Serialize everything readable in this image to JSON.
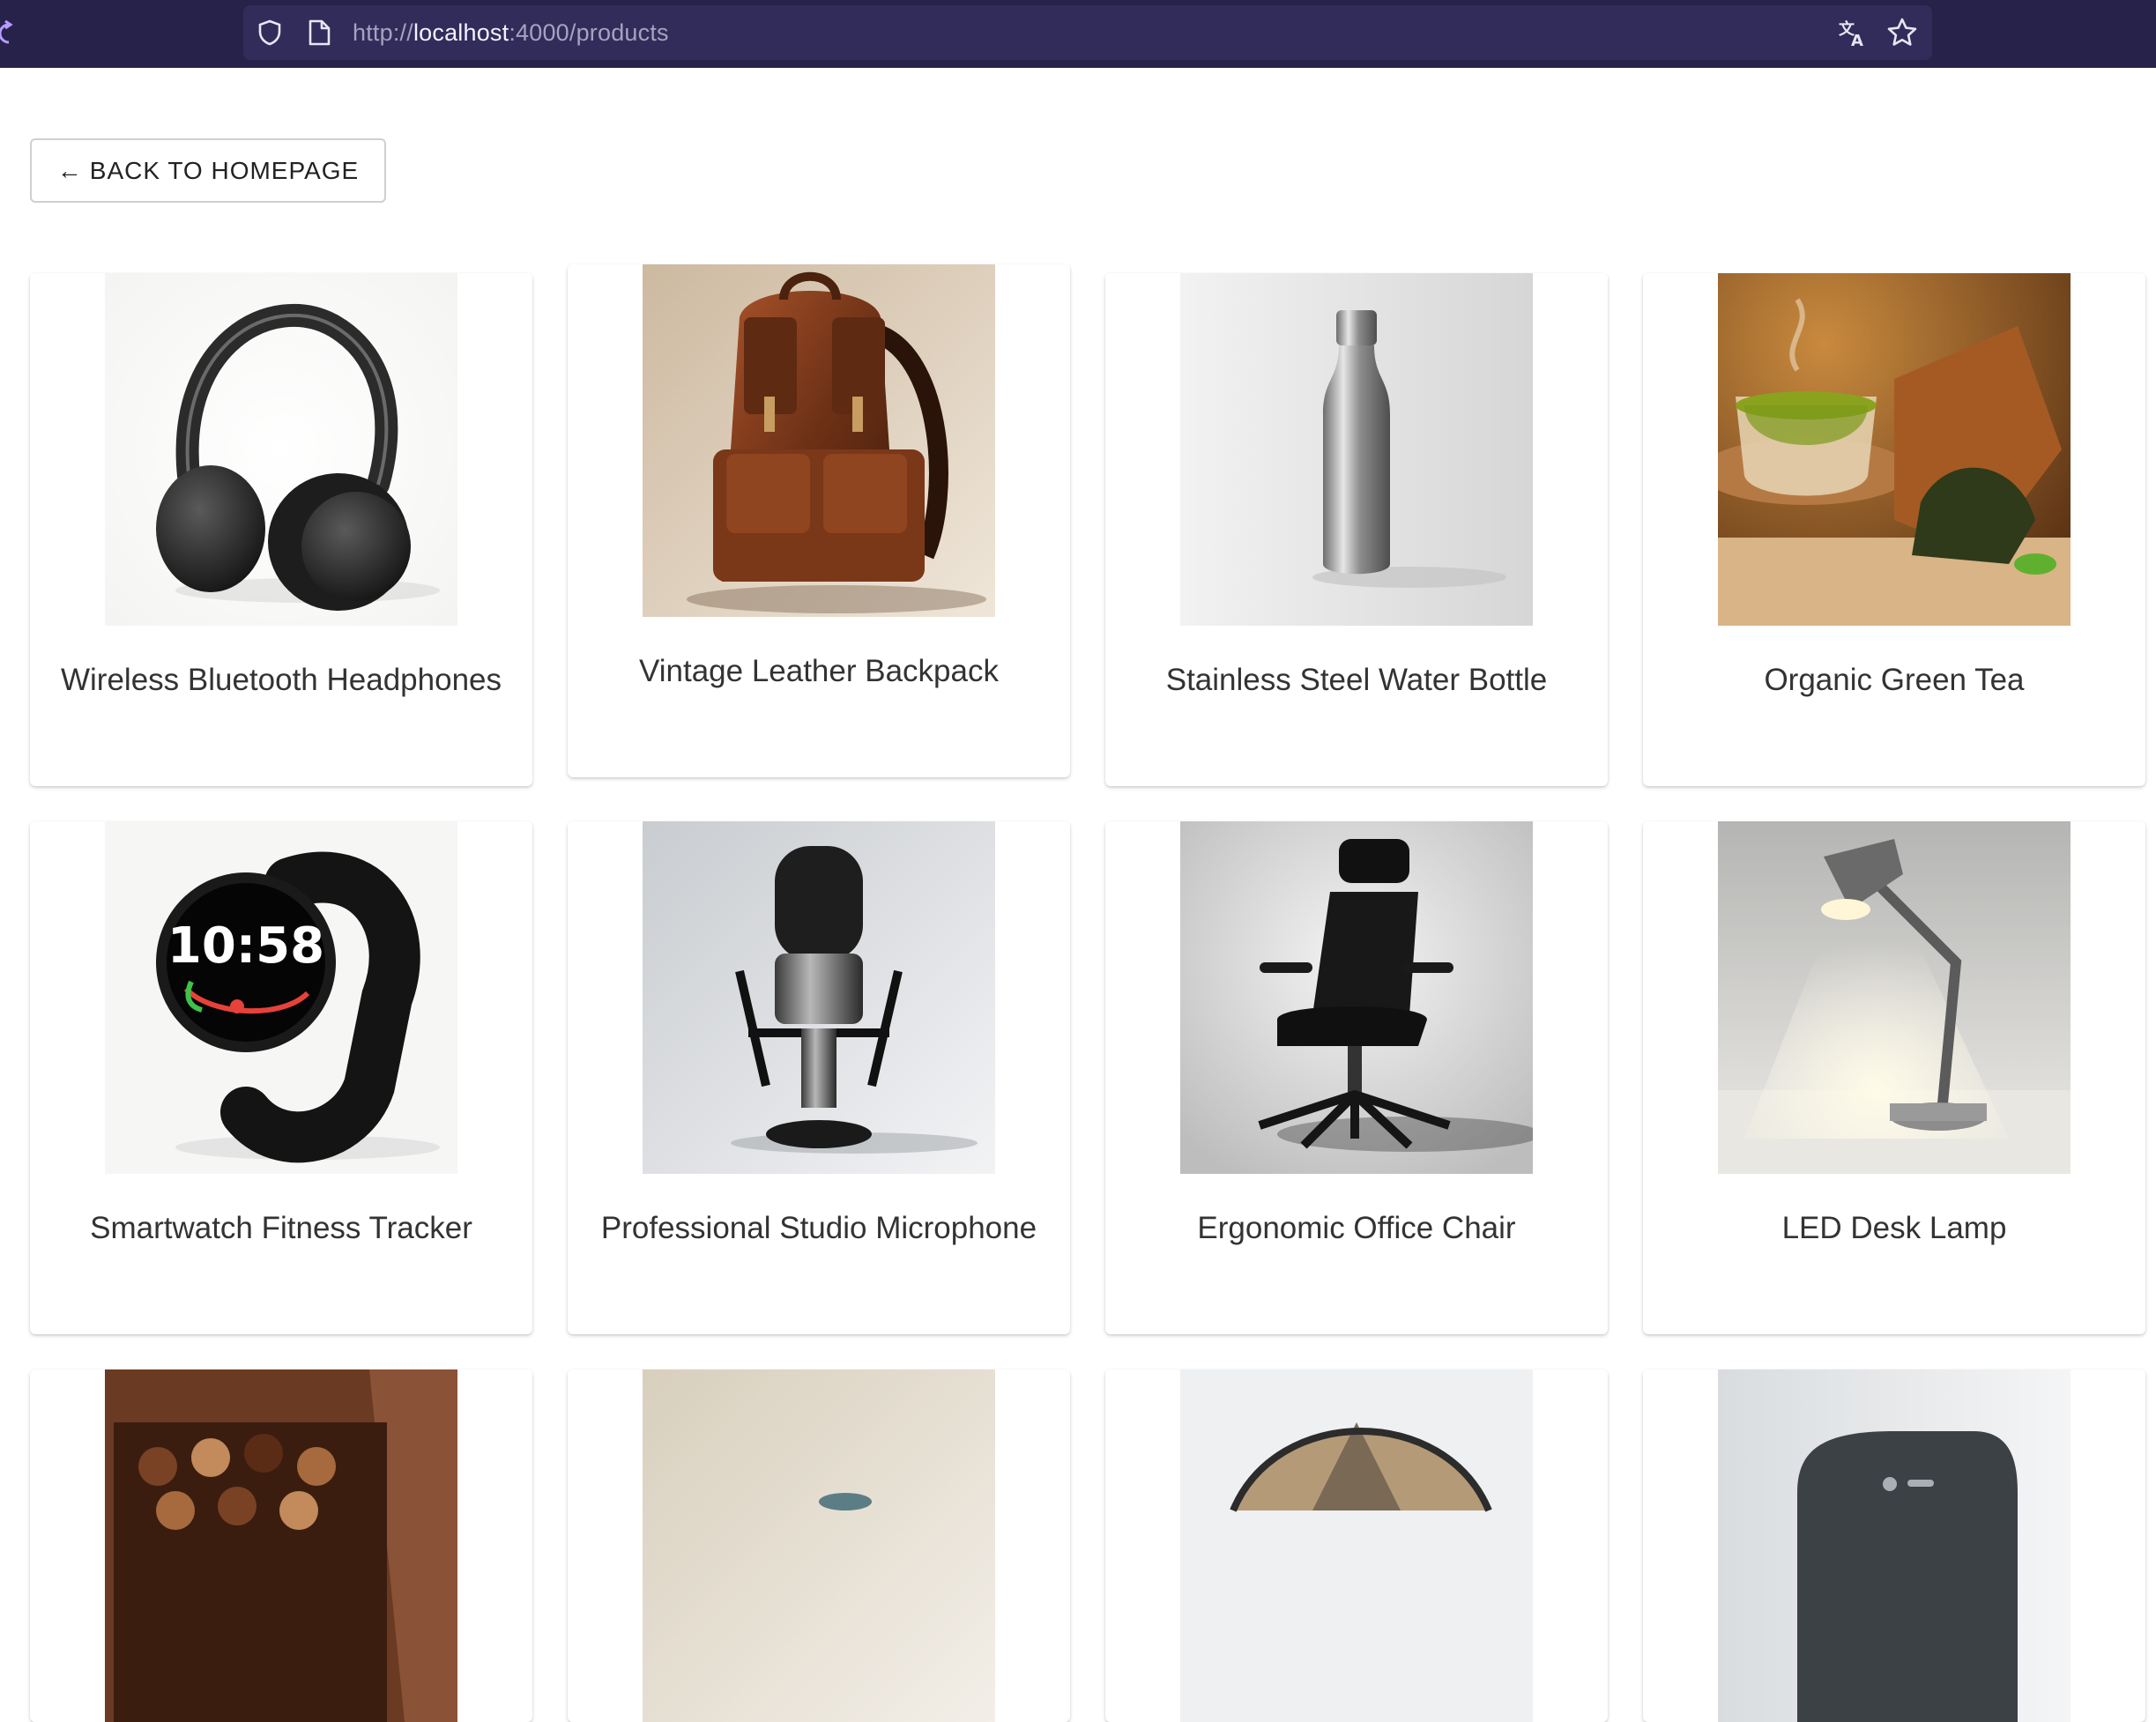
{
  "browser": {
    "url_scheme": "http://",
    "url_host": "localhost",
    "url_rest": ":4000/products"
  },
  "page": {
    "back_button_label": "BACK TO HOMEPAGE",
    "back_arrow": "←"
  },
  "products": [
    {
      "name": "Wireless Bluetooth Headphones",
      "icon": "headphones-image"
    },
    {
      "name": "Vintage Leather Backpack",
      "icon": "backpack-image"
    },
    {
      "name": "Stainless Steel Water Bottle",
      "icon": "water-bottle-image"
    },
    {
      "name": "Organic Green Tea",
      "icon": "green-tea-image"
    },
    {
      "name": "Smartwatch Fitness Tracker",
      "icon": "smartwatch-image",
      "watch_time": "10:58"
    },
    {
      "name": "Professional Studio Microphone",
      "icon": "microphone-image"
    },
    {
      "name": "Ergonomic Office Chair",
      "icon": "office-chair-image"
    },
    {
      "name": "LED Desk Lamp",
      "icon": "desk-lamp-image"
    },
    {
      "name": "",
      "icon": "chocolates-image"
    },
    {
      "name": "",
      "icon": "product-image"
    },
    {
      "name": "",
      "icon": "tent-image"
    },
    {
      "name": "",
      "icon": "gadget-image"
    }
  ]
}
